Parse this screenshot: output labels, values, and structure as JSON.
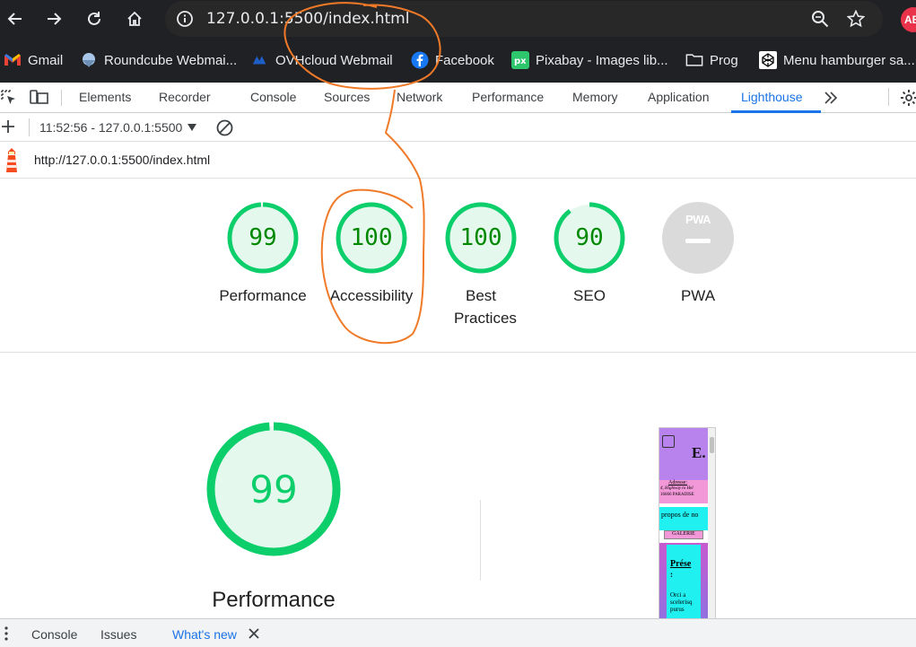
{
  "browser": {
    "url": "127.0.0.1:5500/index.html",
    "bookmarks": [
      {
        "label": "Gmail",
        "icon": "gmail-icon"
      },
      {
        "label": "Roundcube Webmai...",
        "icon": "roundcube-icon"
      },
      {
        "label": "OVHcloud Webmail",
        "icon": "ovhcloud-icon"
      },
      {
        "label": "Facebook",
        "icon": "facebook-icon"
      },
      {
        "label": "Pixabay - Images lib...",
        "icon": "pixabay-icon"
      },
      {
        "label": "Prog",
        "icon": "folder-icon"
      },
      {
        "label": "Menu hamburger sa...",
        "icon": "codepen-icon"
      }
    ],
    "profile_badge": "AB"
  },
  "devtools": {
    "tabs": [
      "Elements",
      "Recorder",
      "Console",
      "Sources",
      "Network",
      "Performance",
      "Memory",
      "Application",
      "Lighthouse"
    ],
    "active_tab": "Lighthouse",
    "report_selector": "11:52:56 - 127.0.0.1:5500",
    "report_url": "http://127.0.0.1:5500/index.html"
  },
  "lighthouse": {
    "categories": [
      {
        "score": "99",
        "label": "Performance"
      },
      {
        "score": "100",
        "label": "Accessibility"
      },
      {
        "score": "100",
        "label": "Best Practices"
      },
      {
        "score": "90",
        "label": "SEO"
      },
      {
        "score": "PWA",
        "label": "PWA"
      }
    ],
    "main_score": "99",
    "main_label": "Performance"
  },
  "thumbnail": {
    "heading": "E.",
    "subtitle_1": "Adresse:",
    "subtitle_2": "4, Highway to Hel",
    "subtitle_3": "16666 PARADISE",
    "nav_1": "propos de no",
    "nav_2": "GALERIE",
    "section_title": "Prése",
    "colon": ":",
    "body_1": "Orci a",
    "body_2": "scelerisq",
    "body_3": "purus"
  },
  "drawer": {
    "tabs": [
      "Console",
      "Issues",
      "What's new"
    ]
  },
  "colors": {
    "chrome_bg": "#202124",
    "accent": "#1a73e8",
    "pass_green": "#0cce6b",
    "pass_text": "#008800",
    "annotation": "#f07a28"
  }
}
